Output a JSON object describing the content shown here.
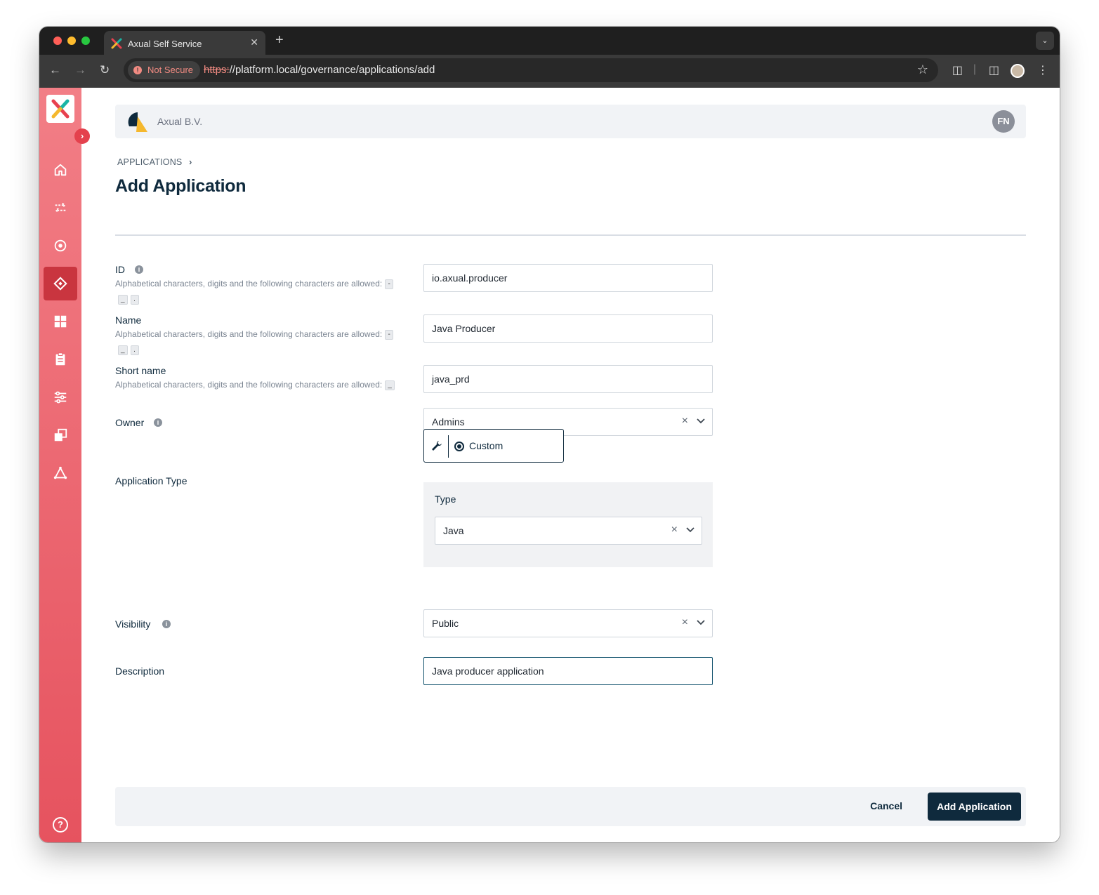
{
  "browser": {
    "tab_title": "Axual Self Service",
    "tab_close": "✕",
    "new_tab": "+",
    "security_label": "Not Secure",
    "url_scheme": "https:",
    "url_rest": "//platform.local/governance/applications/add"
  },
  "topbar": {
    "org_name": "Axual B.V.",
    "avatar_initials": "FN"
  },
  "breadcrumb": {
    "item": "APPLICATIONS",
    "separator": "›"
  },
  "page": {
    "title": "Add Application"
  },
  "form": {
    "id": {
      "label": "ID",
      "hint": "Alphabetical characters, digits and the following characters are allowed:",
      "chips": [
        "-",
        "_",
        "."
      ],
      "value": "io.axual.producer"
    },
    "name": {
      "label": "Name",
      "hint": "Alphabetical characters, digits and the following characters are allowed:",
      "chips": [
        "-",
        "_",
        "."
      ],
      "value": "Java Producer"
    },
    "short_name": {
      "label": "Short name",
      "hint": "Alphabetical characters, digits and the following characters are allowed:",
      "chips": [
        "_"
      ],
      "value": "java_prd"
    },
    "owner": {
      "label": "Owner",
      "value": "Admins"
    },
    "application_type": {
      "label": "Application Type",
      "option": "Custom",
      "type_label": "Type",
      "type_value": "Java"
    },
    "visibility": {
      "label": "Visibility",
      "value": "Public"
    },
    "description": {
      "label": "Description",
      "value": "Java producer application"
    }
  },
  "footer": {
    "cancel_label": "Cancel",
    "submit_label": "Add Application"
  },
  "icons": {
    "sidebar": [
      "home-icon",
      "streams-icon",
      "environments-icon",
      "applications-icon",
      "dashboard-icon",
      "clipboard-icon",
      "settings-sliders-icon",
      "copy-icon",
      "network-icon",
      "help-icon"
    ]
  },
  "colors": {
    "sidebar_top": "#f27e86",
    "sidebar_bottom": "#e6535f",
    "primary_dark": "#0f2a3d",
    "panel_bg": "#f1f3f6"
  }
}
